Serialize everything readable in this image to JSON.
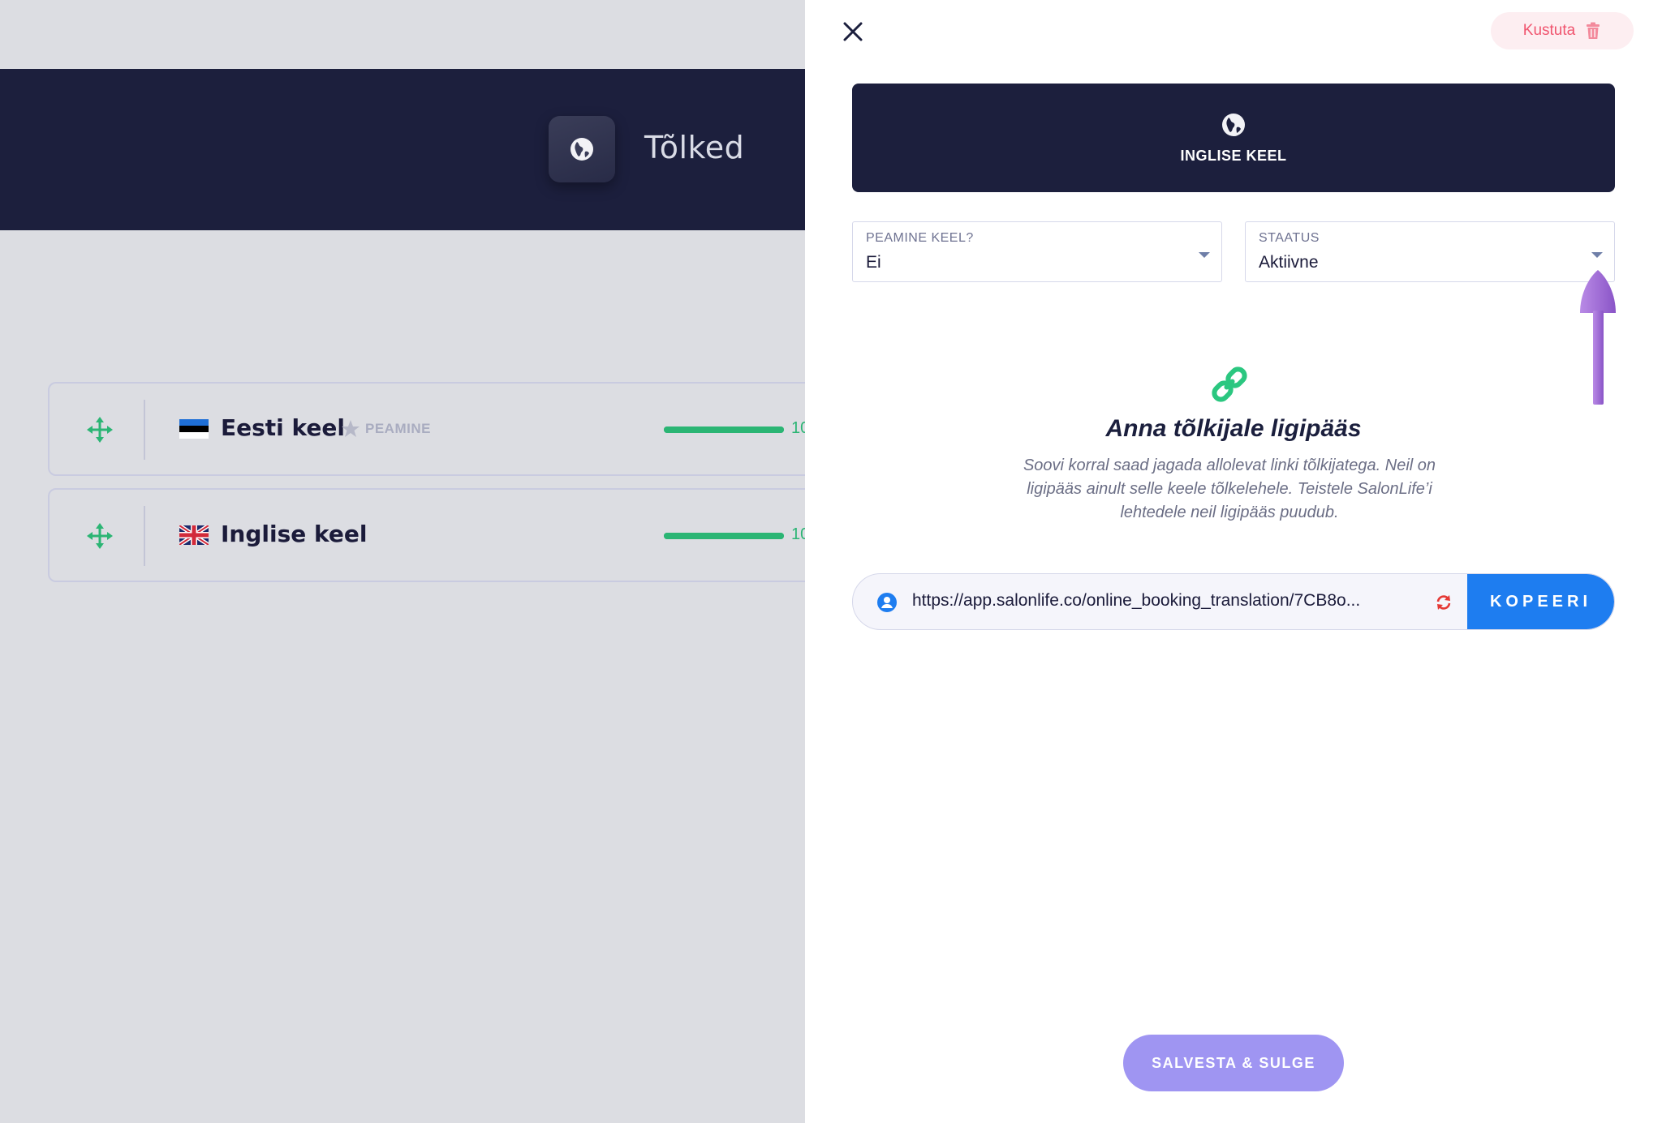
{
  "background": {
    "header": {
      "title": "Tõlked",
      "icon": "globe-icon"
    },
    "languages": [
      {
        "name": "Eesti keel",
        "flag": "flag-estonia-icon",
        "is_main": true,
        "main_label": "PEAMINE",
        "progress": 1.0,
        "progress_label": "10"
      },
      {
        "name": "Inglise keel",
        "flag": "flag-uk-icon",
        "is_main": false,
        "progress": 1.0,
        "progress_label": "10"
      }
    ]
  },
  "drawer": {
    "close_icon": "close-icon",
    "delete_label": "Kustuta",
    "language_card": {
      "title": "INGLISE KEEL",
      "icon": "globe-icon"
    },
    "fields": {
      "main_language": {
        "label": "PEAMINE KEEL?",
        "value": "Ei"
      },
      "status": {
        "label": "STAATUS",
        "value": "Aktiivne"
      }
    },
    "access": {
      "title": "Anna tõlkijale ligipääs",
      "description": "Soovi korral saad jagada allolevat linki tõlkijatega. Neil on ligipääs ainult selle keele tõlkelehele. Teistele SalonLife’i lehtedele neil ligipääs puudub.",
      "url": "https://app.salonlife.co/online_booking_translation/7CB8o...",
      "copy_label": "KOPEERI"
    },
    "save_label": "SALVESTA & SULGE"
  },
  "colors": {
    "header_bg": "#1c1f3d",
    "accent_green": "#2bb574",
    "delete_red": "#f0556f",
    "copy_blue": "#1e7df0",
    "save_purple": "#9f95f2",
    "annotation_purple": "#a06ad6"
  }
}
